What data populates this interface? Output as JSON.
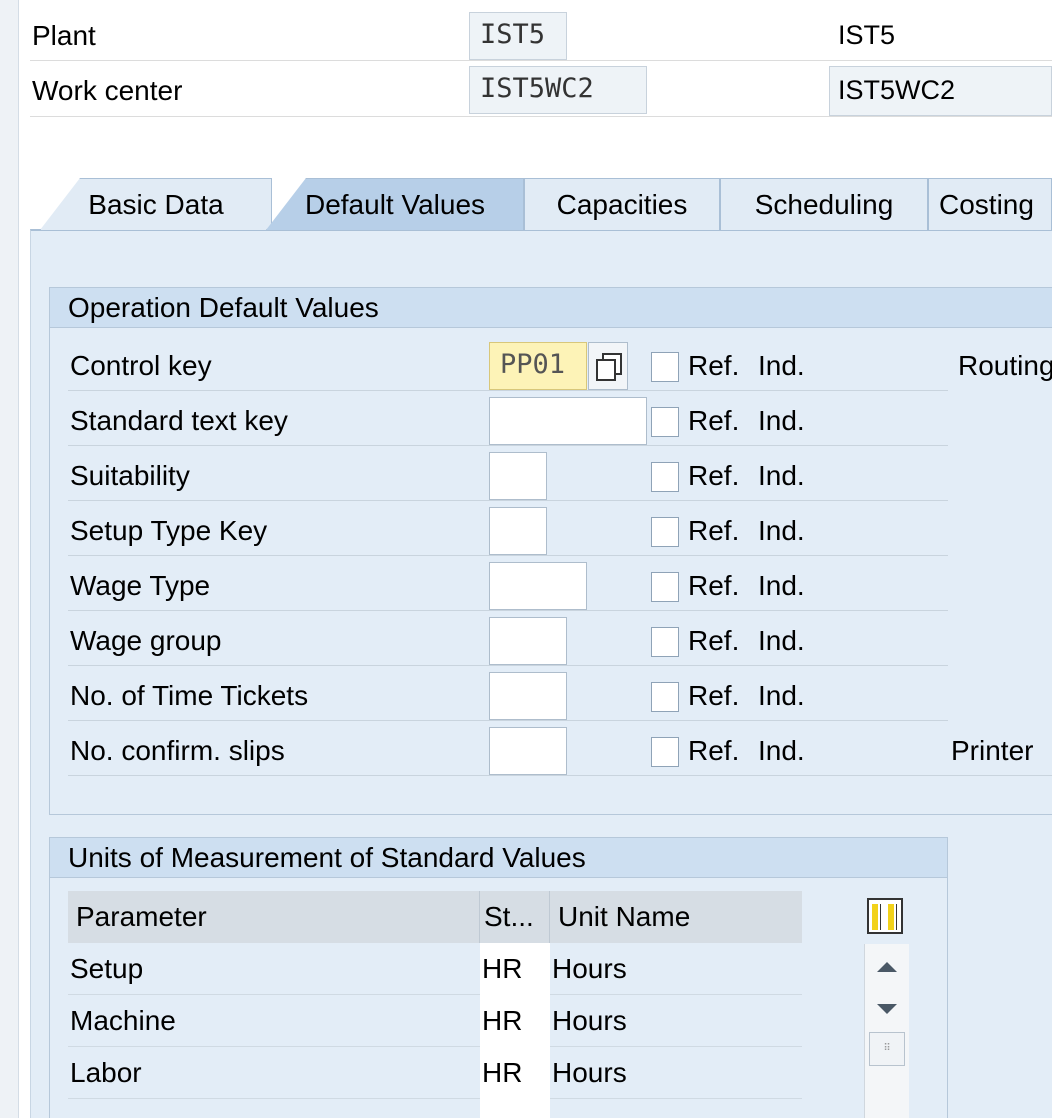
{
  "header": {
    "plant": {
      "label": "Plant",
      "value": "IST5",
      "description": "IST5"
    },
    "work_center": {
      "label": "Work center",
      "value": "IST5WC2",
      "description": "IST5WC2"
    }
  },
  "tabs": [
    {
      "label": "Basic Data",
      "active": false
    },
    {
      "label": "Default Values",
      "active": true
    },
    {
      "label": "Capacities",
      "active": false
    },
    {
      "label": "Scheduling",
      "active": false
    },
    {
      "label": "Costing",
      "active": false
    }
  ],
  "operation_defaults": {
    "title": "Operation Default Values",
    "ref_label": "Ref.",
    "ind_label": "Ind.",
    "rows": [
      {
        "label": "Control key",
        "value": "PP01",
        "side_text": "Routing"
      },
      {
        "label": "Standard text key",
        "value": ""
      },
      {
        "label": "Suitability",
        "value": ""
      },
      {
        "label": "Setup Type Key",
        "value": ""
      },
      {
        "label": "Wage Type",
        "value": ""
      },
      {
        "label": "Wage group",
        "value": ""
      },
      {
        "label": "No. of Time Tickets",
        "value": ""
      },
      {
        "label": "No. confirm. slips",
        "value": "",
        "side_text": "Printer"
      }
    ]
  },
  "units": {
    "title": "Units of Measurement of Standard Values",
    "columns": [
      "Parameter",
      "St...",
      "Unit Name"
    ],
    "rows": [
      {
        "parameter": "Setup",
        "std": "HR",
        "unit_name": "Hours"
      },
      {
        "parameter": "Machine",
        "std": "HR",
        "unit_name": "Hours"
      },
      {
        "parameter": "Labor",
        "std": "HR",
        "unit_name": "Hours"
      }
    ]
  },
  "colors": {
    "tab_active": "#b7cfe8",
    "panel_bg": "#e3edf7",
    "required_field": "#fdf3b7"
  },
  "icons": {
    "value_help": "value-help-icon",
    "table_settings": "table-settings-icon",
    "scroll_up": "scroll-up-icon",
    "scroll_down": "scroll-down-icon"
  }
}
